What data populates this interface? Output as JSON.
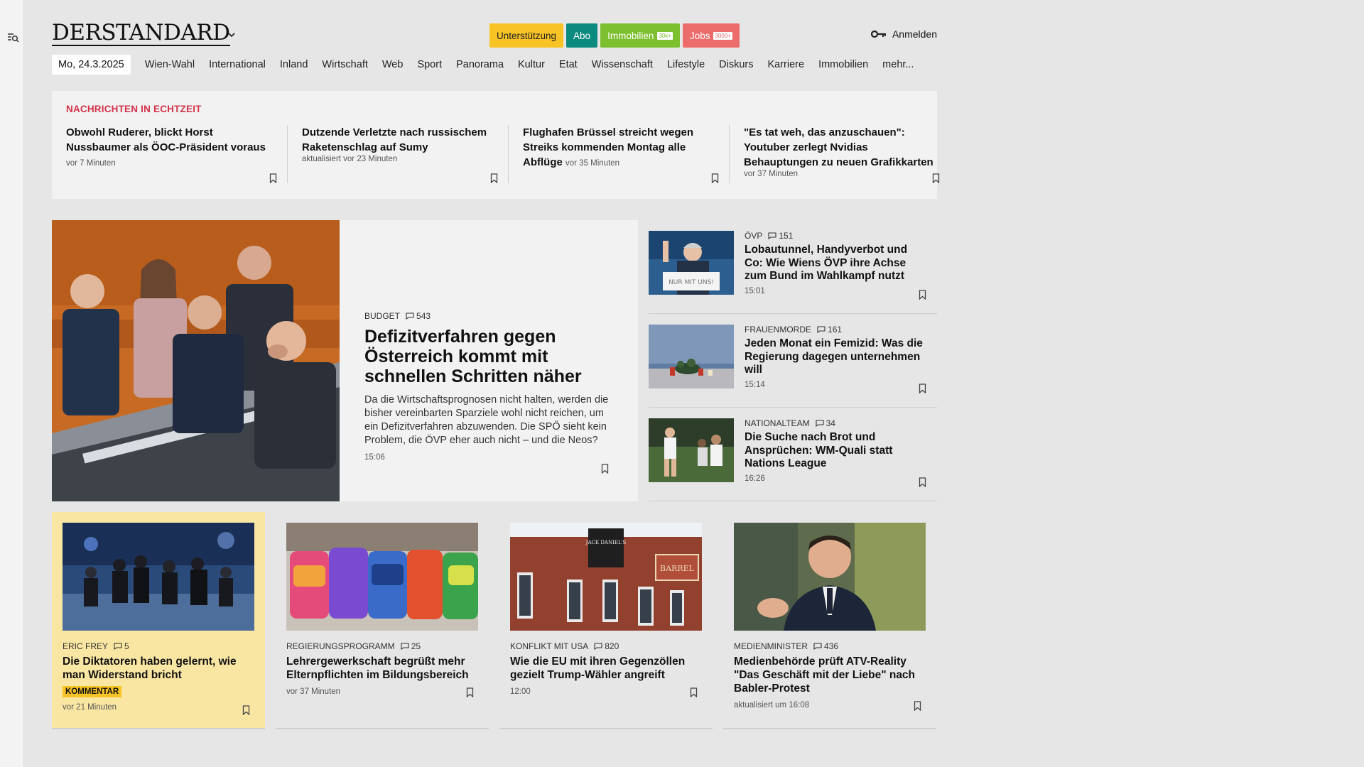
{
  "brand": {
    "logo": "DERSTANDARD",
    "accent": "#d43249"
  },
  "header": {
    "buttons": {
      "support": "Unterstützung",
      "abo": "Abo",
      "immobilien": "Immobilien",
      "immobilien_badge": "30k+",
      "jobs": "Jobs",
      "jobs_badge": "3000+"
    },
    "login": "Anmelden"
  },
  "nav": {
    "date": "Mo, 24.3.2025",
    "items": [
      "Wien-Wahl",
      "International",
      "Inland",
      "Wirtschaft",
      "Web",
      "Sport",
      "Panorama",
      "Kultur",
      "Etat",
      "Wissenschaft",
      "Lifestyle",
      "Diskurs",
      "Karriere",
      "Immobilien",
      "mehr..."
    ]
  },
  "realtime": {
    "heading": "NACHRICHTEN IN ECHTZEIT",
    "items": [
      {
        "title": "Obwohl Ruderer, blickt Horst Nussbaumer als ÖOC-Präsident voraus",
        "meta": "vor 7 Minuten"
      },
      {
        "title": "Dutzende Verletzte nach russischem Raketenschlag auf Sumy",
        "meta": "aktualisiert vor 23 Minuten"
      },
      {
        "title": "Flughafen Brüssel streicht wegen Streiks kommenden Montag alle Abflüge",
        "meta": "vor 35 Minuten"
      },
      {
        "title": "\"Es tat weh, das anzuschauen\": Youtuber zerlegt Nvidias Behauptungen zu neuen Grafikkarten",
        "meta": "vor 37 Minuten"
      }
    ]
  },
  "hero": {
    "kicker": "BUDGET",
    "comments": "543",
    "title": "Defizitverfahren gegen Österreich kommt mit schnellen Schritten näher",
    "lead": "Da die Wirtschaftsprognosen nicht halten, werden die bisher vereinbarten Sparziele wohl nicht reichen, um ein Defizitverfahren abzuwenden. Die SPÖ sieht kein Problem, die ÖVP eher auch nicht – und die Neos?",
    "time": "15:06"
  },
  "side": [
    {
      "kicker": "ÖVP",
      "comments": "151",
      "title": "Lobautunnel, Handyverbot und Co: Wie Wiens ÖVP ihre Achse zum Bund im Wahlkampf nutzt",
      "time": "15:01",
      "img_text": "NUR MIT UNS!"
    },
    {
      "kicker": "FRAUENMORDE",
      "comments": "161",
      "title": "Jeden Monat ein Femizid: Was die Regierung dagegen unternehmen will",
      "time": "15:14"
    },
    {
      "kicker": "NATIONALTEAM",
      "comments": "34",
      "title": "Die Suche nach Brot und Ansprüchen: WM-Quali statt Nations League",
      "time": "16:26"
    }
  ],
  "cards": [
    {
      "kicker": "ERIC FREY",
      "comments": "5",
      "title": "Die Diktatoren haben gelernt, wie man Widerstand bricht",
      "tag": "KOMMENTAR",
      "time": "vor 21 Minuten"
    },
    {
      "kicker": "REGIERUNGSPROGRAMM",
      "comments": "25",
      "title": "Lehrergewerkschaft begrüßt mehr Elternpflichten im Bildungsbereich",
      "time": "vor 37 Minuten"
    },
    {
      "kicker": "KONFLIKT MIT USA",
      "comments": "820",
      "title": "Wie die EU mit ihren Gegenzöllen gezielt Trump-Wähler angreift",
      "time": "12:00",
      "img_text_1": "JACK DANIEL'S",
      "img_text_2": "BARREL"
    },
    {
      "kicker": "MEDIENMINISTER",
      "comments": "436",
      "title": "Medienbehörde prüft ATV-Reality \"Das Geschäft mit der Liebe\" nach Babler-Protest",
      "time": "aktualisiert um 16:08"
    }
  ]
}
